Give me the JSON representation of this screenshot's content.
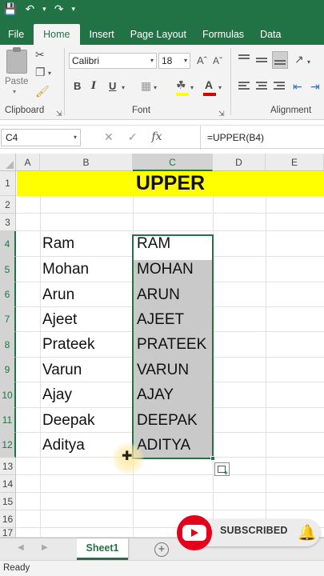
{
  "ribbon_tabs": [
    "File",
    "Home",
    "Insert",
    "Page Layout",
    "Formulas",
    "Data"
  ],
  "active_tab": "Home",
  "ribbon": {
    "clipboard_label": "Clipboard",
    "paste_label": "Paste",
    "font_label": "Font",
    "alignment_label": "Alignment",
    "font_name": "Calibri",
    "font_size": "18",
    "bold_label": "B",
    "italic_label": "I",
    "underline_label": "U"
  },
  "formula_bar": {
    "name_box": "C4",
    "fx_label": "fx",
    "formula": "=UPPER(B4)"
  },
  "columns": [
    "A",
    "B",
    "C",
    "D",
    "E"
  ],
  "selected_column": "C",
  "rows": [
    "1",
    "2",
    "3",
    "4",
    "5",
    "6",
    "7",
    "8",
    "9",
    "10",
    "11",
    "12",
    "13",
    "14",
    "15",
    "16",
    "17"
  ],
  "title_cell": "UPPER",
  "names": [
    "Ram",
    "Mohan",
    "Arun",
    "Ajeet",
    "Prateek",
    "Varun",
    "Ajay",
    "Deepak",
    "Aditya"
  ],
  "upper_names": [
    "RAM",
    "MOHAN",
    "ARUN",
    "AJEET",
    "PRATEEK",
    "VARUN",
    "AJAY",
    "DEEPAK",
    "ADITYA"
  ],
  "sheet_tab": "Sheet1",
  "add_sheet_label": "+",
  "status": "Ready",
  "subscribe_label": "SUBSCRIBED",
  "colors": {
    "excel_green": "#217346",
    "title_fill": "#ffff00",
    "selection_fill": "#c9c9c9",
    "youtube_red": "#e4001b"
  }
}
